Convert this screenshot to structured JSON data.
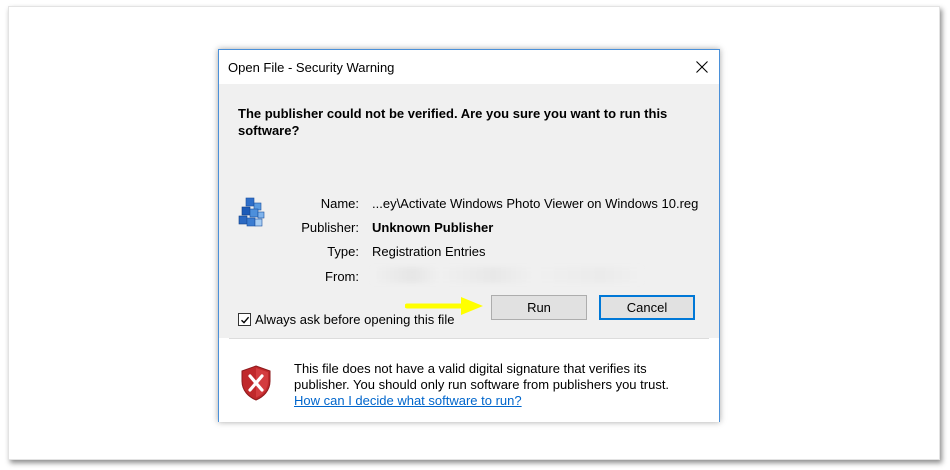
{
  "dialog": {
    "title": "Open File - Security Warning",
    "heading": "The publisher could not be verified.  Are you sure you want to run this software?",
    "fields": [
      {
        "label": "Name:",
        "value": "...ey\\Activate Windows Photo Viewer on Windows 10.reg",
        "bold": false
      },
      {
        "label": "Publisher:",
        "value": "Unknown Publisher",
        "bold": true
      },
      {
        "label": "Type:",
        "value": "Registration Entries",
        "bold": false
      },
      {
        "label": "From:",
        "value": "",
        "bold": false
      }
    ],
    "run_label": "Run",
    "cancel_label": "Cancel",
    "checkbox_label": "Always ask before opening this file",
    "checkbox_checked": true,
    "warning_text": "This file does not have a valid digital signature that verifies its publisher.  You should only run software from publishers you trust.",
    "help_link": "How can I decide what software to run?"
  },
  "icons": {
    "close": "close-icon",
    "file": "registry-file-icon",
    "arrow": "arrow-right-icon",
    "shield": "shield-warning-icon"
  },
  "colors": {
    "accent": "#0078d7",
    "arrow": "#ffff00",
    "shield": "#c0282b",
    "link": "#0066cc"
  }
}
